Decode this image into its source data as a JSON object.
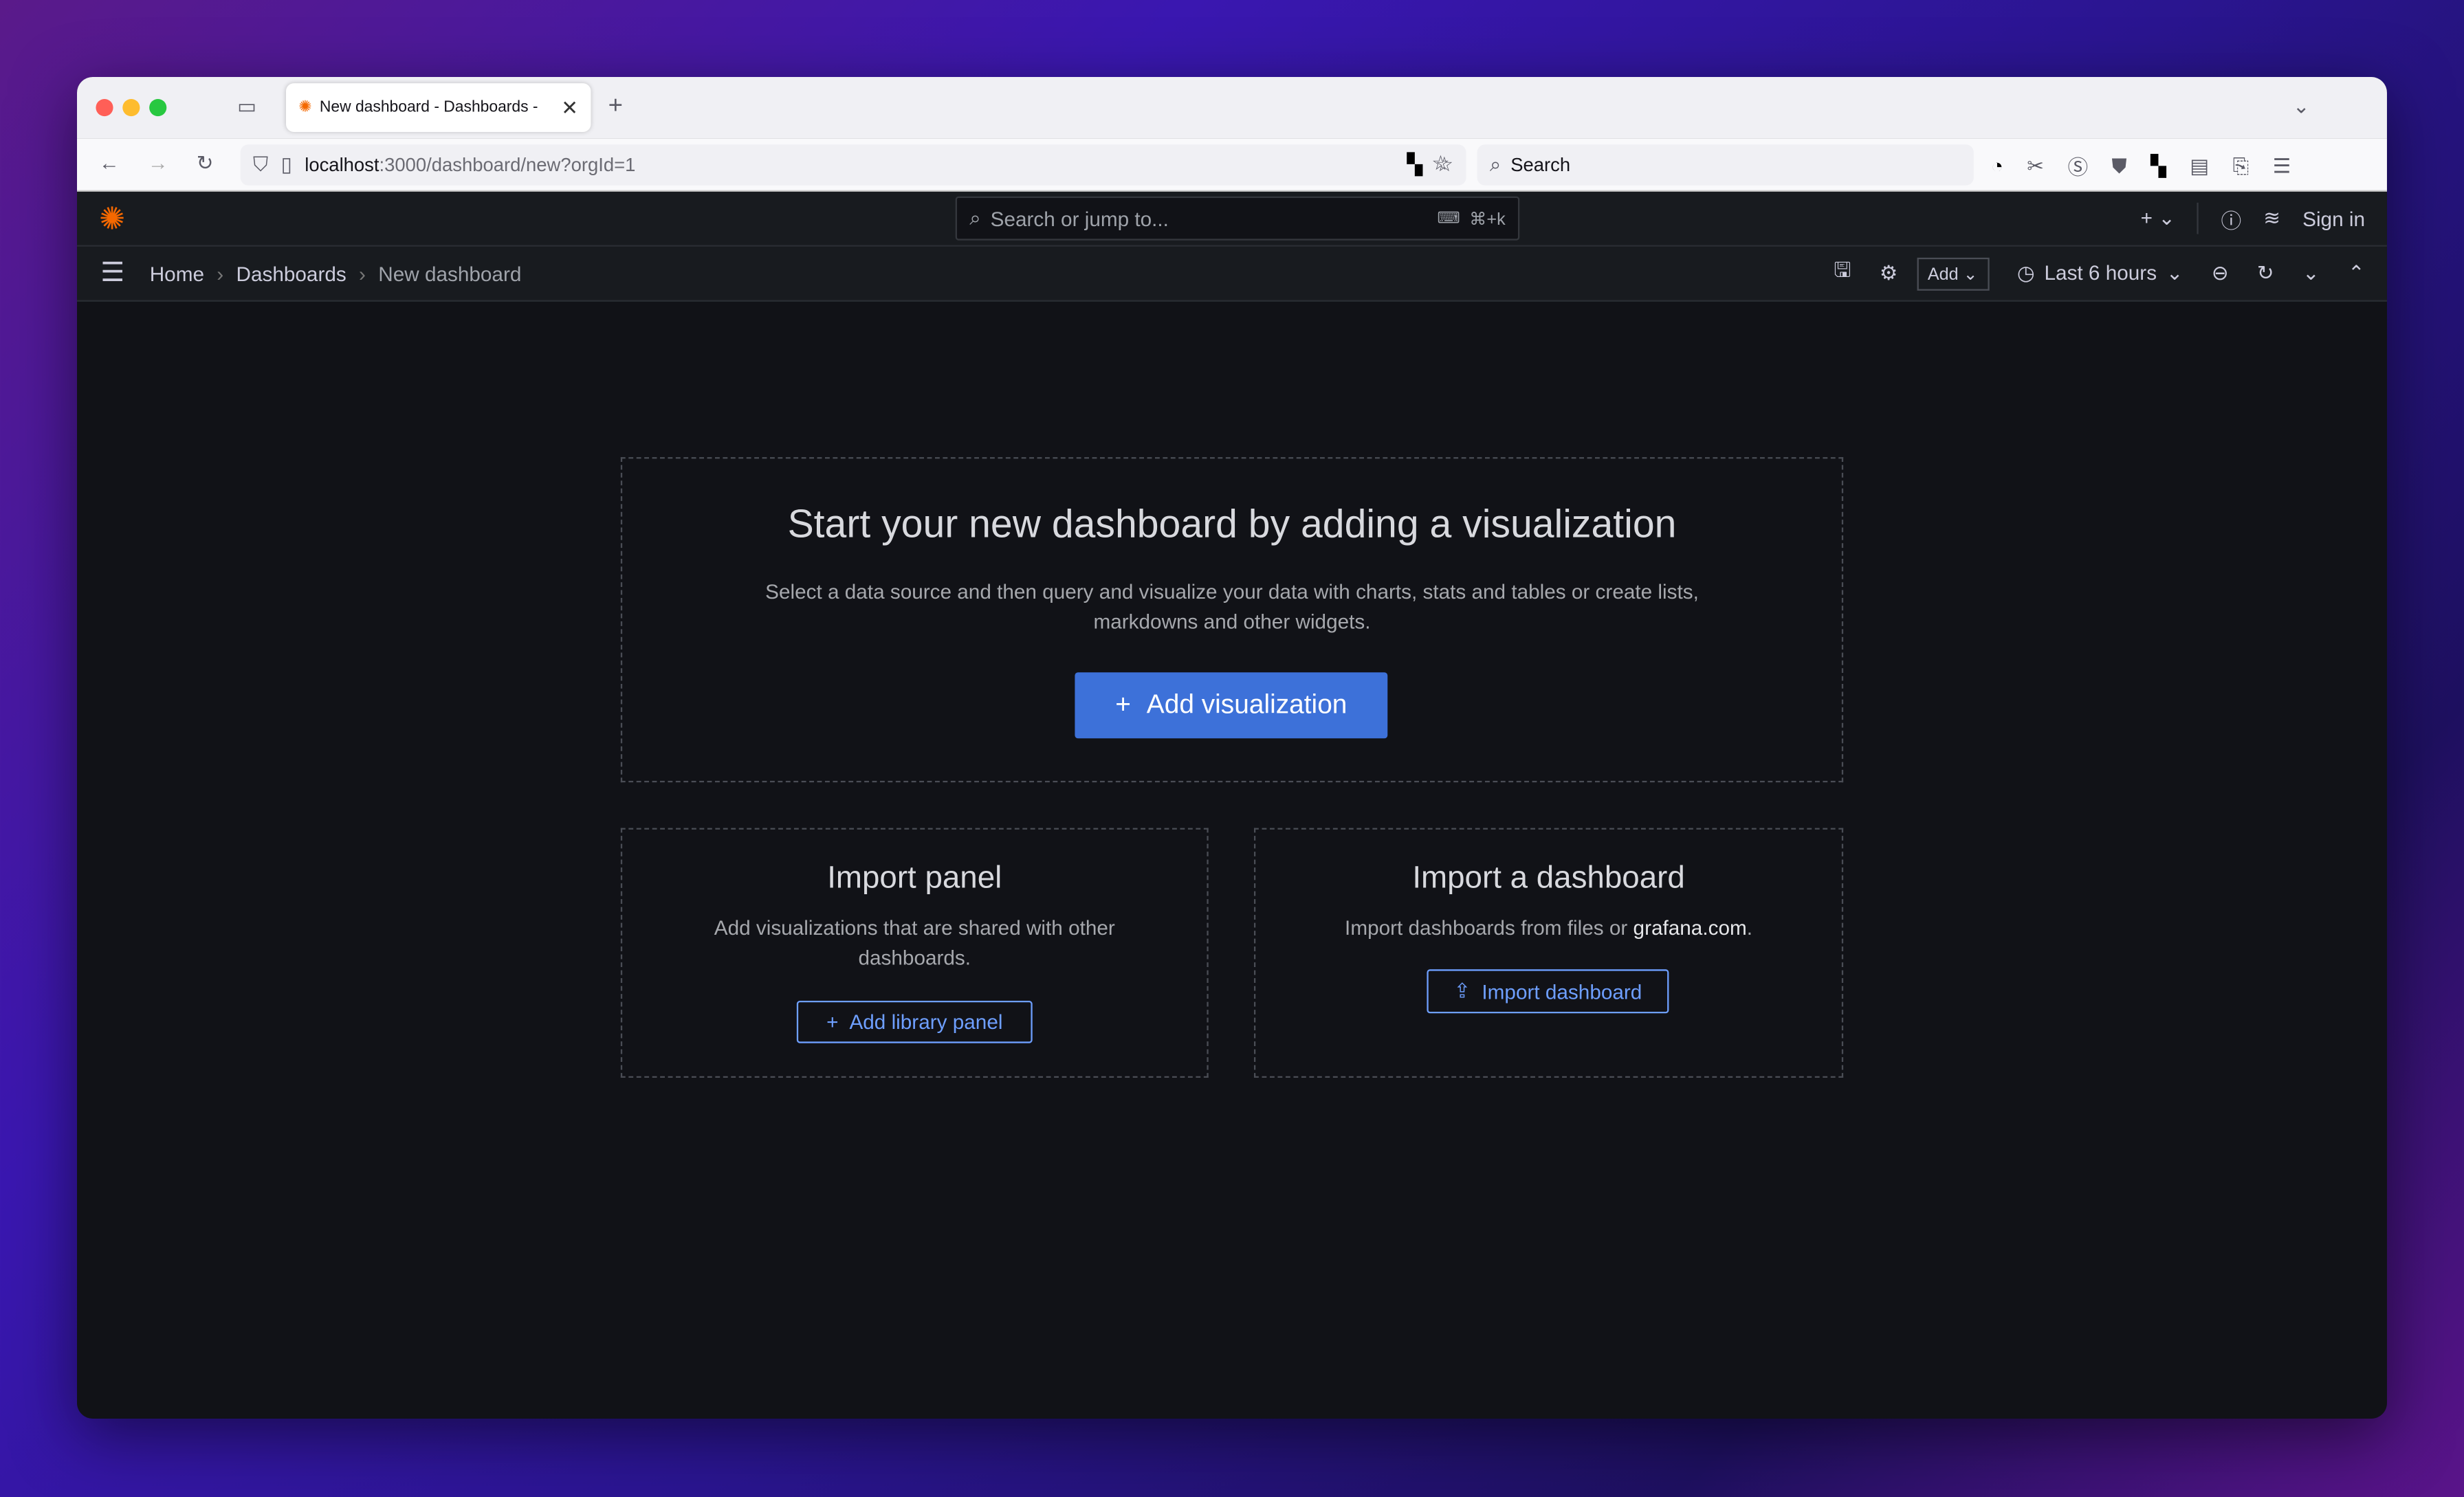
{
  "browser": {
    "tab_title": "New dashboard - Dashboards -",
    "url_host": "localhost",
    "url_path": ":3000/dashboard/new?orgId=1",
    "search_placeholder": "Search"
  },
  "grafana": {
    "search_placeholder": "Search or jump to...",
    "search_shortcut": "⌘+k",
    "sign_in": "Sign in",
    "breadcrumb": [
      "Home",
      "Dashboards",
      "New dashboard"
    ],
    "add_label": "Add",
    "time_range": "Last 6 hours"
  },
  "main": {
    "title": "Start your new dashboard by adding a visualization",
    "subtitle": "Select a data source and then query and visualize your data with charts, stats and tables or create lists, markdowns and other widgets.",
    "add_visualization": "Add visualization",
    "import_panel": {
      "title": "Import panel",
      "desc": "Add visualizations that are shared with other dashboards.",
      "button": "Add library panel"
    },
    "import_dashboard": {
      "title": "Import a dashboard",
      "desc_prefix": "Import dashboards from files or ",
      "link": "grafana.com",
      "desc_suffix": ".",
      "button": "Import dashboard"
    }
  },
  "colors": {
    "primary": "#3d71d9",
    "link": "#6e9fff",
    "bg": "#111217",
    "header": "#181b1f"
  }
}
